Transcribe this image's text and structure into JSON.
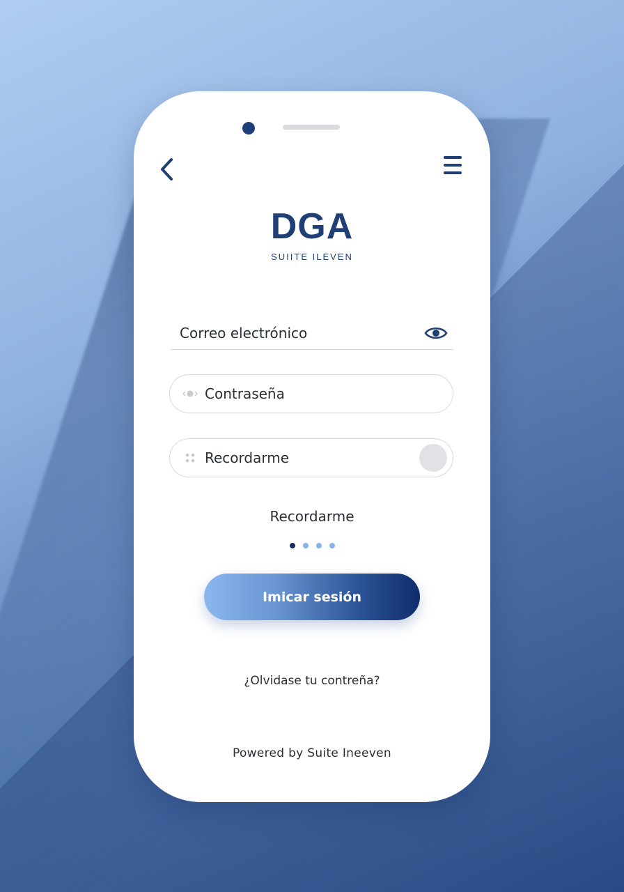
{
  "brand": {
    "title": "DGA",
    "subtitle": "SUIITE ILEVEN",
    "color": "#1f3f75"
  },
  "form": {
    "email_label": "Correo electrónico",
    "password_label": "Contraseña",
    "remember_toggle_label": "Recordarme",
    "remember_text": "Recordarme",
    "login_button": "Imicar sesión",
    "forgot_link": "¿Olvidase tu contreña?"
  },
  "pager": {
    "total": 4,
    "active_index": 0
  },
  "footer": {
    "powered_by": "Powered by Suite Ineeven"
  },
  "icons": {
    "back": "chevron-left-icon",
    "menu": "hamburger-menu-icon",
    "eye": "eye-icon",
    "password": "key-icon",
    "remember": "grip-dots-icon"
  },
  "colors": {
    "accent_dark": "#132f63",
    "accent_light": "#86b4e8",
    "button_start": "#8ab8ee",
    "button_end": "#0f2c6b"
  }
}
